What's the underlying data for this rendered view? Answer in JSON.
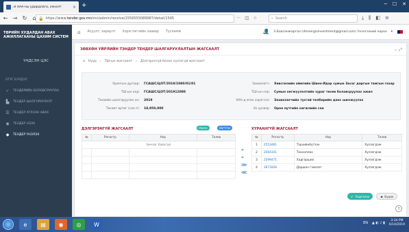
{
  "browser": {
    "tab_title": "ЗГХАА-ны удирдлага, хяналт",
    "url_prefix": "https://www.",
    "url_domain": "tender.gov.mn",
    "url_path": "/mn/admin/receive/1559555089987/detail/1545",
    "search_placeholder": "Search"
  },
  "app": {
    "brand_line1": "ТӨРИЙН ХУДАЛДАН АВАХ",
    "brand_line2": "АЖИЛЛАГААНЫ ЦАХИМ СИСТЕМ",
    "header_links": [
      "Асуулт, хариулт",
      "Хэрэглэгчийн заавар",
      "Тусламж"
    ],
    "user_email": "З.Баасанжаргал (dmnergizinvestment@gmail.com) Үнэлгээний хороо"
  },
  "sidebar": {
    "info": "ҮНДСЭН ЦЭС",
    "heading": "НТУГ БҮРДЭЛ",
    "items": [
      {
        "label": "ТЕНДЕРИЙН БОЛОВСРУУЛАХ",
        "icon": "check-icon"
      },
      {
        "label": "ТЕНДЕР ШАЛГАРУУЛАЛТ",
        "icon": "folder-icon"
      },
      {
        "label": "ТЕНДЕР ХҮЛЭЭН АВАХ",
        "icon": "list-icon"
      },
      {
        "label": "ТЕНДЕР НЭЭХ",
        "icon": "eye-icon"
      },
      {
        "label": "ТЕНДЕР ҮНЭЛЭХ",
        "icon": "tag-icon"
      }
    ]
  },
  "content": {
    "title": "ЗӨВХӨН ҮЙРЛИЙН ТЭНДЕР ТЕНДЕР ШАЛГАРУУЛАЛТЫН ЖАГСААЛТ",
    "breadcrumb": [
      "Нүүр",
      "ТШ-ын жагсаалт",
      "Дэлгэрэнгүй болон хүлээгүй жагсаалт"
    ],
    "info_left": [
      {
        "label": "Урилгын дугаар:",
        "value": "ГСАШС/ЦОТ/2019/1080/01/01"
      },
      {
        "label": "ТШ-ын код:",
        "value": "ГСАШС/ЦОТ/201912088"
      },
      {
        "label": "Төсвийн шалгаруулах он:",
        "value": "2019"
      },
      {
        "label": "Төсөвт өртөг (сая.т):",
        "value": "18,950,000"
      }
    ],
    "info_right": [
      {
        "label": "Захиалагч:",
        "value": "Хөвсгөлийн аймгийн Шинэ-Идэр сумын Засаг даргын тамгын газар"
      },
      {
        "label": "ТШ-ын нэр:",
        "value": "Сумын хөгжүүлэлтийн зураг төсөв боловсруулах ажил"
      },
      {
        "label": "ХАА-д өгөх хэрэгсэл:",
        "value": "Захиалагчийн тусгай төлбөрийн данс шилжүүлэх"
      },
      {
        "label": "Эх үүсвэр:",
        "value": "Орон нутгийн хөгжлийн сан"
      }
    ]
  },
  "left_table": {
    "title": "ДЭЛГЭРЭНГҮЙ ЖАГСААЛТ",
    "btn_new": "Нэмэх",
    "btn_filter": "Нэгтгэх",
    "columns": [
      "№",
      "Регистр",
      "Нэр",
      "Төлөв"
    ],
    "empty_text": "Бичлэг байхгүй"
  },
  "right_table": {
    "title": "ХҮРААНГҮЙ ЖАГСААЛТ",
    "columns": [
      "№",
      "Регистр",
      "Нэр",
      "Төлөв"
    ],
    "rows": [
      {
        "no": "1",
        "reg": "2553481",
        "name": "Тэрхийнбүтээн",
        "status": "Хүлээгдэж"
      },
      {
        "no": "2",
        "reg": "2564341",
        "name": "Техноплан",
        "status": "Хүлээгдэж"
      },
      {
        "no": "3",
        "reg": "2599471",
        "name": "Хадгаршил",
        "status": "Хүлээгдэж"
      },
      {
        "no": "4",
        "reg": "2671826",
        "name": "Даршан гэмэлэг",
        "status": "Хүлээгдэж"
      }
    ],
    "btn_save": "Хадгалах",
    "btn_back": "Буцах"
  },
  "taskbar": {
    "lang": "EN",
    "time": "3:34 PM",
    "date": "6/14/2019"
  }
}
